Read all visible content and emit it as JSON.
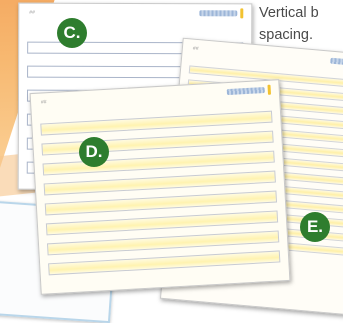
{
  "caption": {
    "line1": "Vertical b",
    "line2": "spacing."
  },
  "sheets": {
    "c": {
      "badge": "C.",
      "corner_number": "##"
    },
    "d": {
      "badge": "D.",
      "corner_number": "##"
    },
    "e": {
      "badge": "E.",
      "corner_number": "##"
    }
  },
  "colors": {
    "badge_green": "#2e7d2e",
    "caption_text": "#4a4a4a",
    "row_outline_blue": "#a9b4c9",
    "row_fill_yellow": "#fff3b0"
  }
}
